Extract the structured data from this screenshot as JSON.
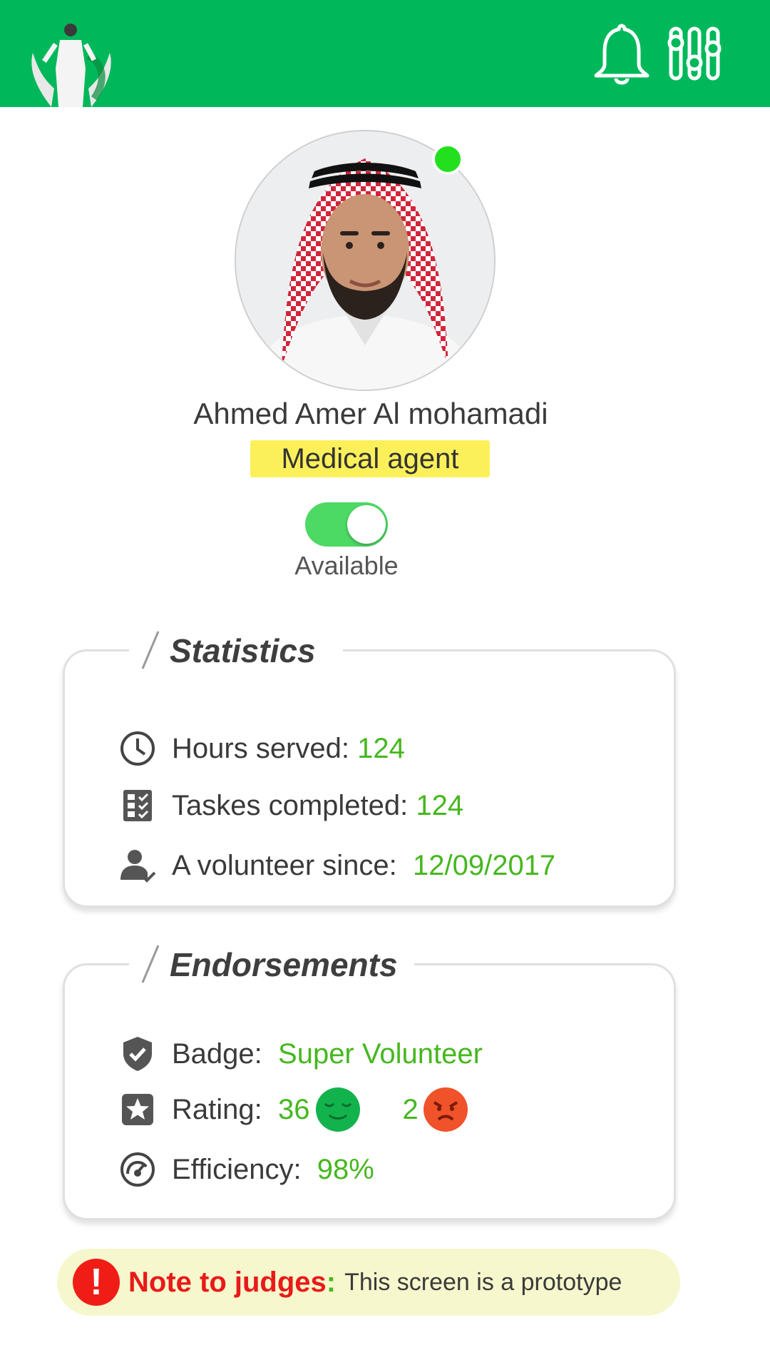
{
  "header": {
    "logo_icon": "hands-holding-person-logo",
    "notifications_icon": "bell-icon",
    "filters_icon": "sliders-icon",
    "background_color": "#00b85a"
  },
  "profile": {
    "name": "Ahmed Amer Al mohamadi",
    "role": "Medical agent",
    "online": true,
    "availability": {
      "enabled": true,
      "label": "Available"
    }
  },
  "statistics": {
    "title": "Statistics",
    "hours_label": "Hours served:",
    "hours_value": "124",
    "tasks_label": "Taskes completed:",
    "tasks_value": "124",
    "since_label": "A volunteer since:",
    "since_value": "12/09/2017"
  },
  "endorsements": {
    "title": "Endorsements",
    "badge_label": "Badge:",
    "badge_value": "Super Volunteer",
    "rating_label": "Rating:",
    "rating_positive": "36",
    "rating_negative": "2",
    "efficiency_label": "Efficiency:",
    "efficiency_value": "98%"
  },
  "note": {
    "title": "Note to judges",
    "colon": ":",
    "text": "This screen is  a prototype"
  },
  "colors": {
    "accent_green": "#46b71f",
    "happy_face": "#12b24d",
    "angry_face": "#f0522a",
    "badge_yellow": "#fbf05a",
    "online_dot": "#22e01e"
  }
}
